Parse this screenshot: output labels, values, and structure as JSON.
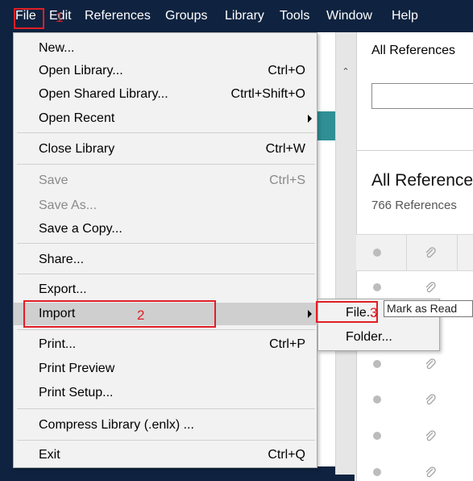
{
  "menubar": {
    "items": [
      "File",
      "Edit",
      "References",
      "Groups",
      "Library",
      "Tools",
      "Window",
      "Help"
    ]
  },
  "file_menu": {
    "items": [
      {
        "label": "New...",
        "shortcut": "",
        "disabled": false
      },
      {
        "label": "Open Library...",
        "shortcut": "Ctrl+O",
        "disabled": false
      },
      {
        "label": "Open Shared Library...",
        "shortcut": "Ctrtl+Shift+O",
        "disabled": false
      },
      {
        "label": "Open Recent",
        "shortcut": "",
        "disabled": false,
        "submenu": true
      },
      {
        "label": "Close Library",
        "shortcut": "Ctrl+W",
        "disabled": false
      },
      {
        "label": "Save",
        "shortcut": "Ctrl+S",
        "disabled": true
      },
      {
        "label": "Save As...",
        "shortcut": "",
        "disabled": true
      },
      {
        "label": "Save a Copy...",
        "shortcut": "",
        "disabled": false
      },
      {
        "label": "Share...",
        "shortcut": "",
        "disabled": false
      },
      {
        "label": "Export...",
        "shortcut": "",
        "disabled": false
      },
      {
        "label": "Import",
        "shortcut": "",
        "disabled": false,
        "submenu": true,
        "highlighted": true
      },
      {
        "label": "Print...",
        "shortcut": "Ctrl+P",
        "disabled": false
      },
      {
        "label": "Print Preview",
        "shortcut": "",
        "disabled": false
      },
      {
        "label": "Print Setup...",
        "shortcut": "",
        "disabled": false
      },
      {
        "label": "Compress Library (.enlx) ...",
        "shortcut": "",
        "disabled": false
      },
      {
        "label": "Exit",
        "shortcut": "Ctrl+Q",
        "disabled": false
      }
    ]
  },
  "import_submenu": {
    "items": [
      {
        "label": "File..."
      },
      {
        "label": "Folder..."
      }
    ]
  },
  "right_pane": {
    "header_title": "All References",
    "search_placeholder": "",
    "heading": "All References",
    "count_text": "766 References"
  },
  "tooltip": "Mark as Read",
  "annotations": {
    "step1": "1",
    "step2": "2",
    "step3": "3"
  },
  "colors": {
    "menubar_bg": "#0f2340",
    "menu_bg": "#f2f2f2",
    "highlight": "#cfcfcf",
    "annotation_red": "#e01f26",
    "accent_teal": "#2f8f95"
  }
}
